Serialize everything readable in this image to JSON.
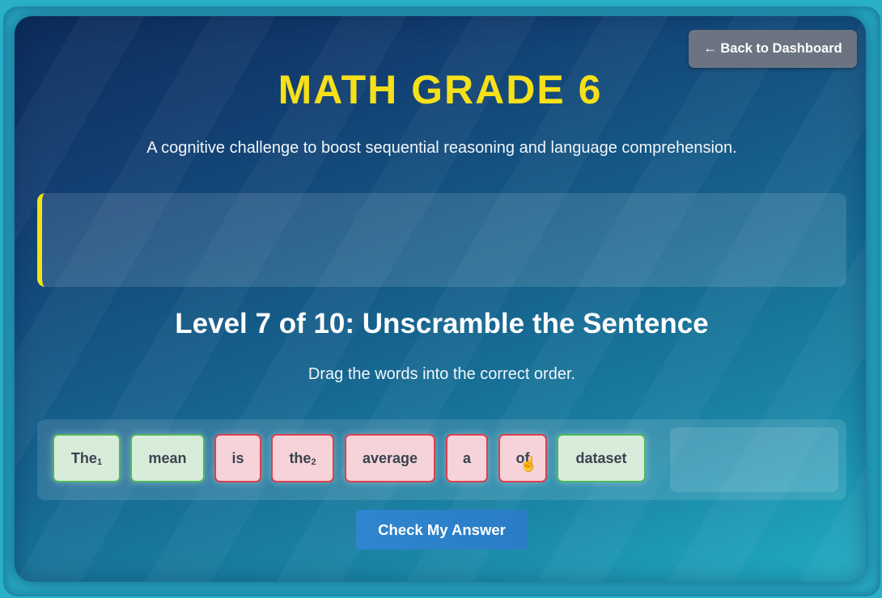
{
  "header": {
    "back_label": "← Back to Dashboard",
    "title": "MATH GRADE 6",
    "subtitle": "A cognitive challenge to boost sequential reasoning and language comprehension."
  },
  "banner": {
    "text": "",
    "accent_color": "#f2e21a"
  },
  "level": {
    "heading": "Level 7 of 10: Unscramble the Sentence",
    "instruction": "Drag the words into the correct order."
  },
  "words": [
    {
      "text": "The",
      "sub": "1",
      "state": "correct"
    },
    {
      "text": "mean",
      "sub": "",
      "state": "correct"
    },
    {
      "text": "is",
      "sub": "",
      "state": "incorrect"
    },
    {
      "text": "the",
      "sub": "2",
      "state": "incorrect"
    },
    {
      "text": "average",
      "sub": "",
      "state": "incorrect"
    },
    {
      "text": "a",
      "sub": "",
      "state": "incorrect"
    },
    {
      "text": "of",
      "sub": "",
      "state": "incorrect"
    },
    {
      "text": "dataset",
      "sub": "",
      "state": "correct"
    }
  ],
  "check_label": "Check My Answer",
  "colors": {
    "title": "#f5e01a",
    "correct_border": "#4cb85a",
    "incorrect_border": "#dc3f4f",
    "check_button": "#2f86cf"
  },
  "cursor_icon": "hand-pointer-icon"
}
